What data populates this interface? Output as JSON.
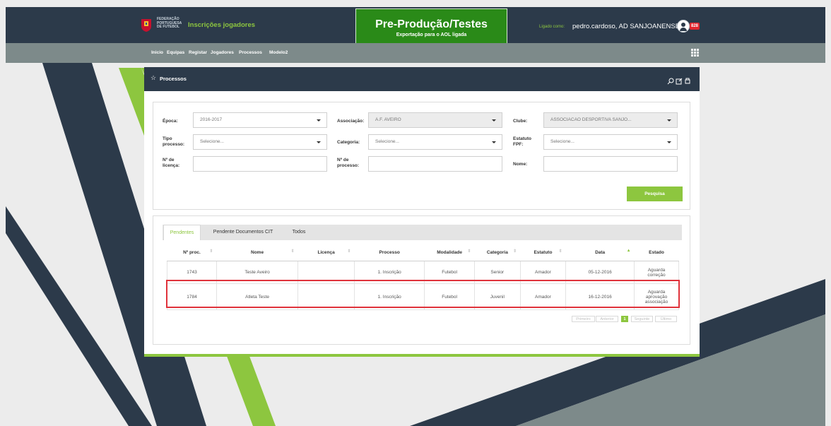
{
  "header": {
    "federation": "FEDERAÇÃO PORTUGUESA DE FUTEBOL",
    "app_title": "Inscrições jogadores",
    "env_title": "Pre-Produção/Testes",
    "env_subtitle": "Exportação para o AOL ligada",
    "logged_label": "Ligado como:",
    "logged_user": "pedro.cardoso, AD SANJOANENSE",
    "notifications": "828"
  },
  "nav": {
    "items": [
      "Inicio",
      "Equipas",
      "Registar",
      "Jogadores",
      "Processos",
      "Modelo2"
    ]
  },
  "panel": {
    "title": "Processos"
  },
  "filters": {
    "epoca_label": "Época:",
    "epoca_value": "2016-2017",
    "associacao_label": "Associação:",
    "associacao_value": "A.F. AVEIRO",
    "clube_label": "Clube:",
    "clube_value": "ASSOCIACAO DESPORTIVA SANJO...",
    "tipo_label_1": "Tipo",
    "tipo_label_2": "processo:",
    "tipo_value": "Selecione...",
    "categoria_label": "Categoria:",
    "categoria_value": "Selecione...",
    "estatuto_label_1": "Estatuto",
    "estatuto_label_2": "FPF:",
    "estatuto_value": "Selecione...",
    "licenca_label_1": "Nº de",
    "licenca_label_2": "licença:",
    "processo_label_1": "Nº de",
    "processo_label_2": "processo:",
    "nome_label": "Nome:",
    "search_button": "Pesquisa"
  },
  "tabs": [
    "Pendentes",
    "Pendente Documentos CIT",
    "Todos"
  ],
  "table": {
    "headers": [
      "Nº proc.",
      "Nome",
      "Licença",
      "Processo",
      "Modalidade",
      "Categoria",
      "Estatuto",
      "Data",
      "Estado"
    ],
    "rows": [
      {
        "proc": "1743",
        "nome": "Teste Aveiro",
        "licenca": "",
        "processo": "1. Inscrição",
        "modalidade": "Futebol",
        "categoria": "Senior",
        "estatuto": "Amador",
        "data": "05-12-2016",
        "estado_1": "Aguarda",
        "estado_2": "correção",
        "estado_3": ""
      },
      {
        "proc": "1784",
        "nome": "Atleta Teste",
        "licenca": "",
        "processo": "1. Inscrição",
        "modalidade": "Futebol",
        "categoria": "Juvenil",
        "estatuto": "Amador",
        "data": "16-12-2016",
        "estado_1": "Aguarda",
        "estado_2": "aprovação",
        "estado_3": "associação"
      }
    ]
  },
  "pagination": {
    "first": "Primeiro",
    "prev": "Anterior",
    "current": "1",
    "next": "Seguinte",
    "last": "Último"
  },
  "colors": {
    "brand_green": "#8dc63f",
    "header_dark": "#2c3a4a",
    "env_green": "#2a8a18",
    "highlight_red": "#e0323b"
  }
}
